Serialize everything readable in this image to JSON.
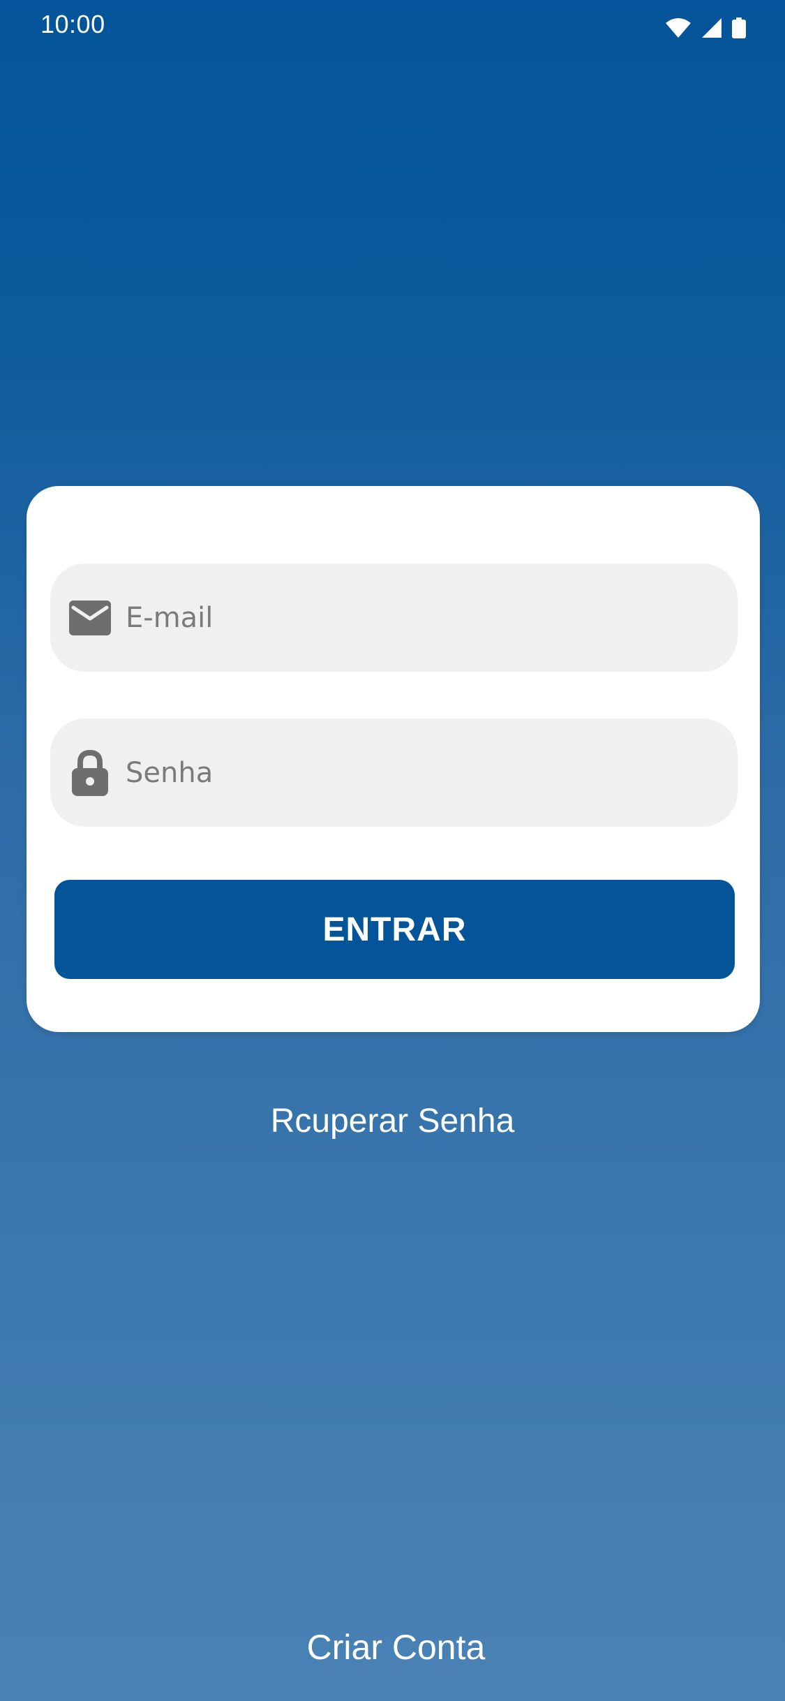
{
  "status_bar": {
    "time": "10:00",
    "icons": [
      "wifi-icon",
      "cell-signal-icon",
      "battery-icon"
    ]
  },
  "login_card": {
    "email": {
      "icon": "mail-icon",
      "placeholder": "E-mail",
      "value": ""
    },
    "password": {
      "icon": "lock-icon",
      "placeholder": "Senha",
      "value": ""
    },
    "submit_label": "ENTRAR"
  },
  "links": {
    "recover_password": "Rcuperar Senha",
    "create_account": "Criar Conta"
  },
  "colors": {
    "primary": "#04549a",
    "gradient_top": "#03549a",
    "gradient_bottom": "#4a82b5",
    "field_background": "#f0f0f0",
    "icon_gray": "#6e6e6e",
    "text_on_primary": "#ffffff"
  }
}
